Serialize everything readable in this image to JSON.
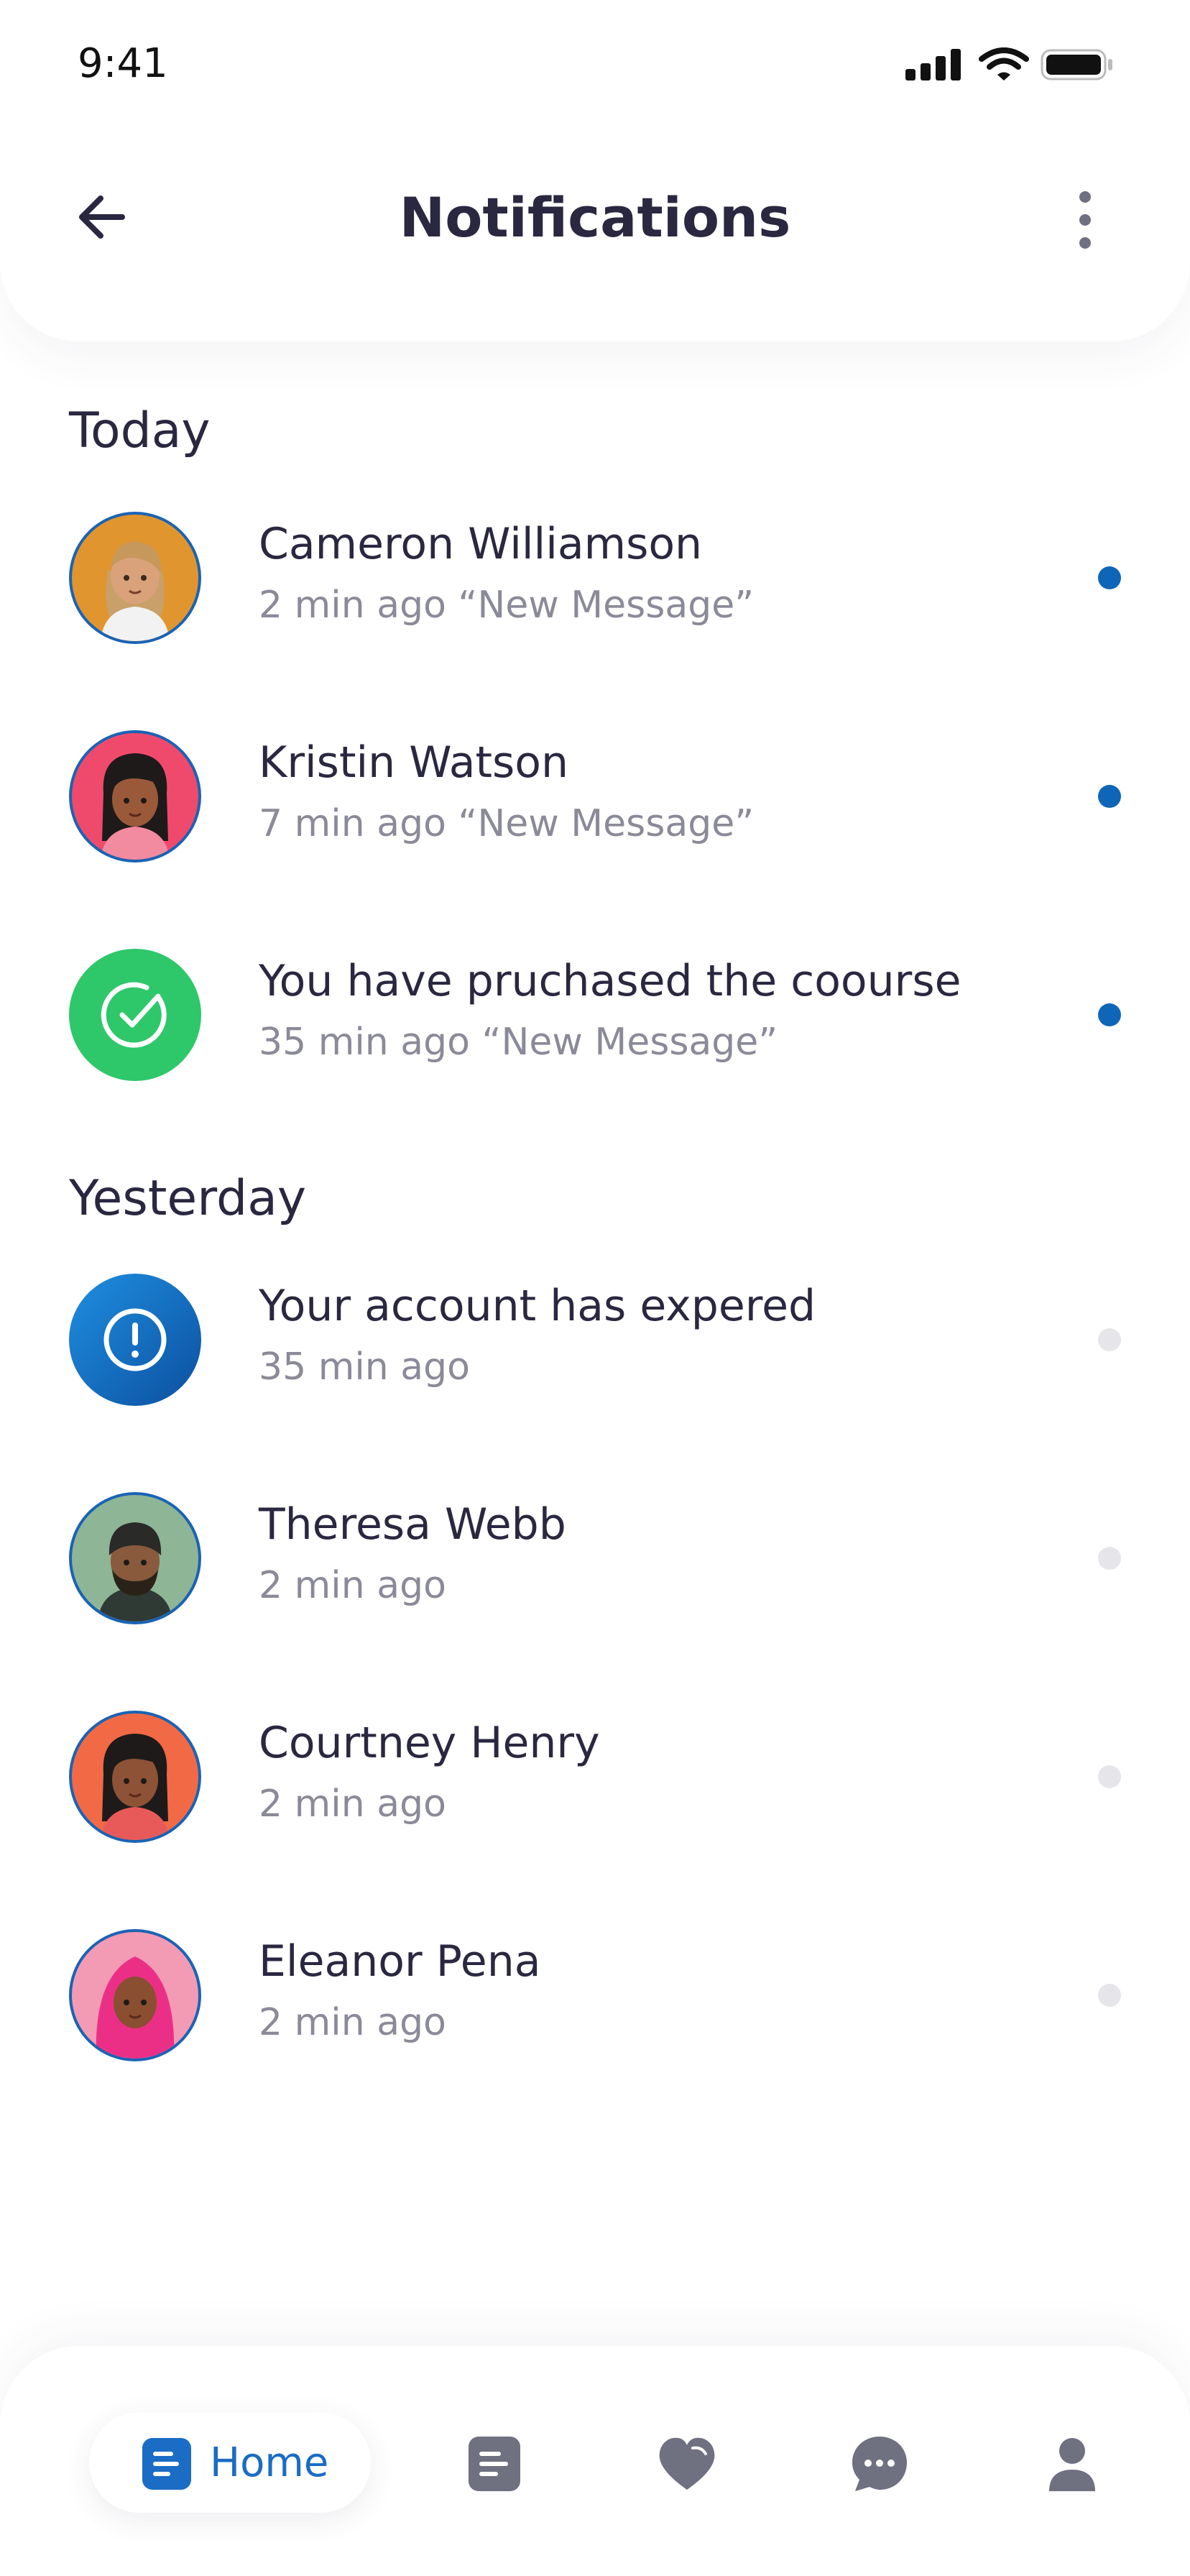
{
  "status_bar": {
    "time": "9:41"
  },
  "header": {
    "title": "Notifications"
  },
  "sections": [
    {
      "label": "Today"
    },
    {
      "label": "Yesterday"
    }
  ],
  "notifications": [
    {
      "title": "Cameron Williamson",
      "subtitle": "2 min ago “New Message”",
      "unread": true,
      "avatar": "avatar-cameron"
    },
    {
      "title": "Kristin Watson",
      "subtitle": "7 min ago “New Message”",
      "unread": true,
      "avatar": "avatar-kristin"
    },
    {
      "title": "You have pruchased the coourse",
      "subtitle": "35 min ago “New Message”",
      "unread": true,
      "avatar": "check-circle-icon"
    },
    {
      "title": "Your account has expered",
      "subtitle": "35 min ago",
      "unread": false,
      "avatar": "alert-circle-icon"
    },
    {
      "title": "Theresa Webb",
      "subtitle": "2 min ago",
      "unread": false,
      "avatar": "avatar-theresa"
    },
    {
      "title": "Courtney Henry",
      "subtitle": "2 min ago",
      "unread": false,
      "avatar": "avatar-courtney"
    },
    {
      "title": "Eleanor Pena",
      "subtitle": "2 min ago",
      "unread": false,
      "avatar": "avatar-eleanor"
    }
  ],
  "tabbar": {
    "home_label": "Home",
    "tabs": [
      "document-icon",
      "heart-icon",
      "chat-icon",
      "profile-icon"
    ]
  },
  "colors": {
    "accent": "#1a6cc4",
    "unread_dot": "#0f66b8",
    "read_dot": "#e6e6ea",
    "success": "#2ec76a",
    "icon_gray": "#6f7080"
  }
}
